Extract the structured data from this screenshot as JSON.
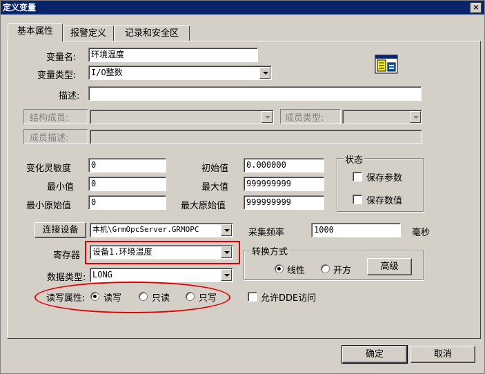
{
  "window": {
    "title": "定义变量",
    "close_glyph": "×"
  },
  "tabs": [
    {
      "label": "基本属性",
      "active": true
    },
    {
      "label": "报警定义",
      "active": false
    },
    {
      "label": "记录和安全区",
      "active": false
    }
  ],
  "fields": {
    "var_name_label": "变量名:",
    "var_name_value": "环境温度",
    "var_type_label": "变量类型:",
    "var_type_value": "I/O整数",
    "desc_label": "描述:",
    "desc_value": "",
    "struct_member_label": "结构成员:",
    "member_type_label": "成员类型:",
    "member_desc_label": "成员描述:",
    "sensitivity_label": "变化灵敏度",
    "sensitivity_value": "0",
    "initial_label": "初始值",
    "initial_value": "0.000000",
    "min_label": "最小值",
    "min_value": "0",
    "max_label": "最大值",
    "max_value": "999999999",
    "min_raw_label": "最小原始值",
    "min_raw_value": "0",
    "max_raw_label": "最大原始值",
    "max_raw_value": "999999999",
    "connect_device_button": "连接设备",
    "device_value": "本机\\GrmOpcServer.GRMOPC",
    "sample_rate_label": "采集频率",
    "sample_rate_value": "1000",
    "sample_rate_unit": "毫秒",
    "register_label": "寄存器",
    "register_value": "设备1.环境温度",
    "data_type_label": "数据类型:",
    "data_type_value": "LONG",
    "rw_label": "读写属性:",
    "rw_options": [
      "读写",
      "只读",
      "只写"
    ],
    "rw_selected": 0,
    "dde_label": "允许DDE访问"
  },
  "status_group": {
    "title": "状态",
    "save_params": "保存参数",
    "save_values": "保存数值"
  },
  "conversion_group": {
    "title": "转换方式",
    "options": [
      "线性",
      "开方"
    ],
    "selected": 0,
    "advanced_button": "高级"
  },
  "footer": {
    "ok": "确定",
    "cancel": "取消"
  },
  "colors": {
    "titlebar": "#0a246a",
    "face": "#d4d0c8",
    "highlight_annotation": "#e00000"
  }
}
